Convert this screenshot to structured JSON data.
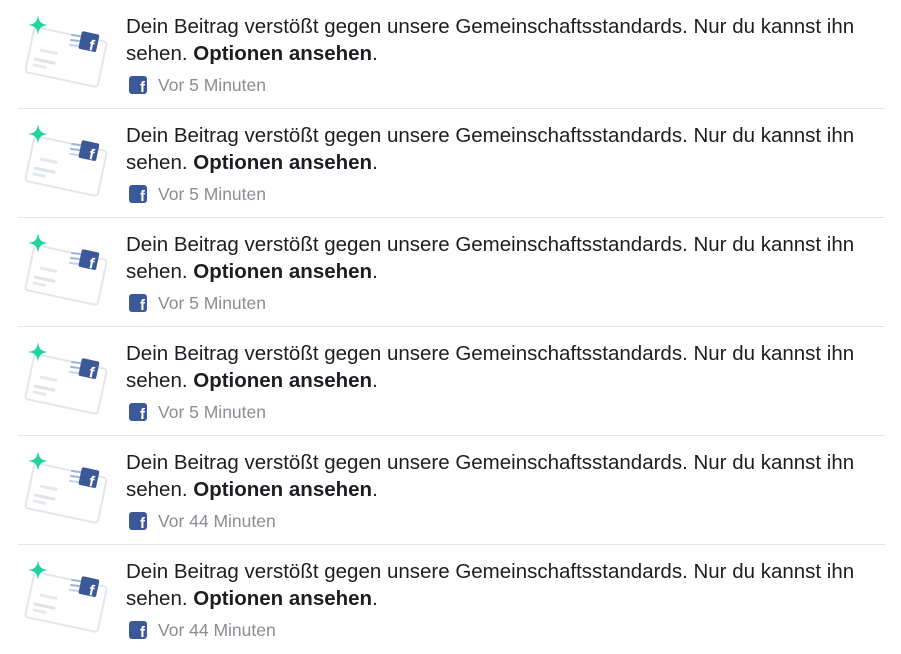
{
  "notifications": [
    {
      "text": "Dein Beitrag verstößt gegen unsere Gemeinschaftsstandards. Nur du kannst ihn sehen. ",
      "action": "Optionen ansehen",
      "suffix": ".",
      "time": "Vor 5 Minuten",
      "source_icon": "facebook-icon"
    },
    {
      "text": "Dein Beitrag verstößt gegen unsere Gemeinschaftsstandards. Nur du kannst ihn sehen. ",
      "action": "Optionen ansehen",
      "suffix": ".",
      "time": "Vor 5 Minuten",
      "source_icon": "facebook-icon"
    },
    {
      "text": "Dein Beitrag verstößt gegen unsere Gemeinschaftsstandards. Nur du kannst ihn sehen. ",
      "action": "Optionen ansehen",
      "suffix": ".",
      "time": "Vor 5 Minuten",
      "source_icon": "facebook-icon"
    },
    {
      "text": "Dein Beitrag verstößt gegen unsere Gemeinschaftsstandards. Nur du kannst ihn sehen. ",
      "action": "Optionen ansehen",
      "suffix": ".",
      "time": "Vor 5 Minuten",
      "source_icon": "facebook-icon"
    },
    {
      "text": "Dein Beitrag verstößt gegen unsere Gemeinschaftsstandards. Nur du kannst ihn sehen. ",
      "action": "Optionen ansehen",
      "suffix": ".",
      "time": "Vor 44 Minuten",
      "source_icon": "facebook-icon"
    },
    {
      "text": "Dein Beitrag verstößt gegen unsere Gemeinschaftsstandards. Nur du kannst ihn sehen. ",
      "action": "Optionen ansehen",
      "suffix": ".",
      "time": "Vor 44 Minuten",
      "source_icon": "facebook-icon"
    }
  ],
  "badge_glyph": "f",
  "colors": {
    "brand": "#3b5998",
    "sparkle": "#1ed4a0",
    "text": "#1c1e21",
    "muted": "#8a8d91",
    "divider": "#e4e6eb"
  }
}
